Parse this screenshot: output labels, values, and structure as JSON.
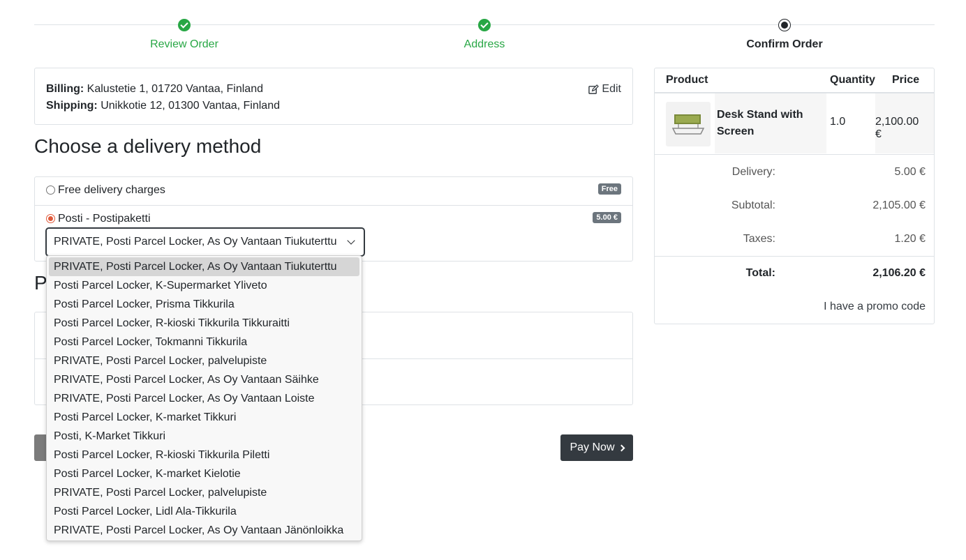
{
  "steps": [
    {
      "label": "Review Order",
      "state": "done"
    },
    {
      "label": "Address",
      "state": "done"
    },
    {
      "label": "Confirm Order",
      "state": "current"
    }
  ],
  "address": {
    "billing_label": "Billing:",
    "billing_value": "Kalustetie 1, 01720 Vantaa, Finland",
    "shipping_label": "Shipping:",
    "shipping_value": "Unikkotie 12, 01300 Vantaa, Finland",
    "edit_label": "Edit"
  },
  "delivery": {
    "title": "Choose a delivery method",
    "methods": [
      {
        "label": "Free delivery charges",
        "badge": "Free",
        "selected": false
      },
      {
        "label": "Posti - Postipaketti",
        "badge": "5.00 €",
        "selected": true
      }
    ],
    "select_value": "PRIVATE, Posti Parcel Locker, As Oy Vantaan Tiukuterttu",
    "options": [
      "PRIVATE, Posti Parcel Locker, As Oy Vantaan Tiukuterttu",
      "Posti Parcel Locker, K-Supermarket Yliveto",
      "Posti Parcel Locker, Prisma Tikkurila",
      "Posti Parcel Locker, R-kioski Tikkurila Tikkuraitti",
      "Posti Parcel Locker, Tokmanni Tikkurila",
      "PRIVATE, Posti Parcel Locker, palvelupiste",
      "PRIVATE, Posti Parcel Locker, As Oy Vantaan Säihke",
      "PRIVATE, Posti Parcel Locker, As Oy Vantaan Loiste",
      "Posti Parcel Locker, K-market Tikkuri",
      "Posti, K-Market Tikkuri",
      "Posti Parcel Locker, R-kioski Tikkurila Piletti",
      "Posti Parcel Locker, K-market Kielotie",
      "PRIVATE, Posti Parcel Locker, palvelupiste",
      "Posti Parcel Locker, Lidl Ala-Tikkurila",
      "PRIVATE, Posti Parcel Locker, As Oy Vantaan Jänönloikka"
    ]
  },
  "payment": {
    "title_partial": "P"
  },
  "buttons": {
    "pay_now": "Pay Now"
  },
  "summary": {
    "headers": {
      "product": "Product",
      "quantity": "Quantity",
      "price": "Price"
    },
    "product": {
      "name": "Desk Stand with Screen",
      "quantity": "1.0",
      "price": "2,100.00 €"
    },
    "delivery_label": "Delivery:",
    "delivery_value": "5.00 €",
    "subtotal_label": "Subtotal:",
    "subtotal_value": "2,105.00 €",
    "taxes_label": "Taxes:",
    "taxes_value": "1.20 €",
    "total_label": "Total:",
    "total_value": "2,106.20 €",
    "promo_label": "I have a promo code"
  },
  "colors": {
    "success": "#28a745",
    "dark": "#343a40",
    "radio_accent": "#e05a3b",
    "badge": "#6c757d"
  }
}
